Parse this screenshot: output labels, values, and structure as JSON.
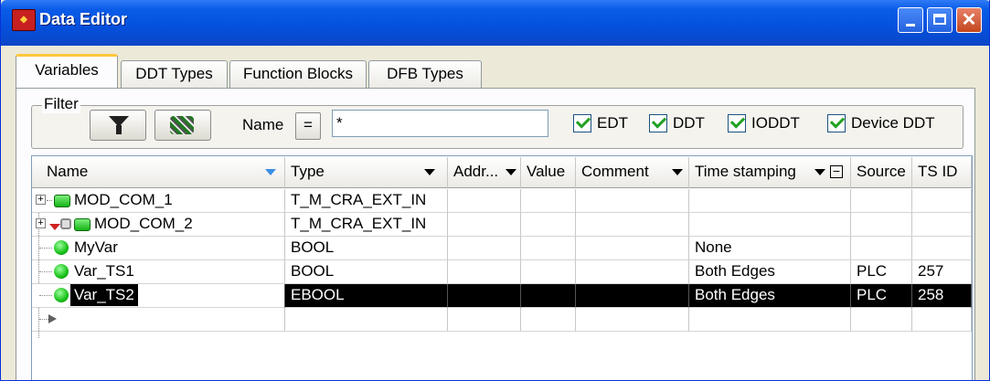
{
  "window": {
    "title": "Data Editor",
    "app_icon": "data-editor-icon"
  },
  "tabs": [
    {
      "label": "Variables",
      "active": true
    },
    {
      "label": "DDT Types",
      "active": false
    },
    {
      "label": "Function Blocks",
      "active": false
    },
    {
      "label": "DFB Types",
      "active": false
    }
  ],
  "filter": {
    "legend": "Filter",
    "name_label": "Name",
    "eq_label": "=",
    "name_value": "*",
    "checks": [
      {
        "label": "EDT",
        "checked": true
      },
      {
        "label": "DDT",
        "checked": true
      },
      {
        "label": "IODDT",
        "checked": true
      },
      {
        "label": "Device DDT",
        "checked": true
      }
    ]
  },
  "columns": [
    "Name",
    "Type",
    "Addr...",
    "Value",
    "Comment",
    "Time stamping",
    "Source",
    "TS ID"
  ],
  "rows": [
    {
      "name": "MOD_COM_1",
      "type": "T_M_CRA_EXT_IN",
      "time_stamping": "",
      "source": "",
      "ts_id": ""
    },
    {
      "name": "MOD_COM_2",
      "type": "T_M_CRA_EXT_IN",
      "time_stamping": "",
      "source": "",
      "ts_id": ""
    },
    {
      "name": "MyVar",
      "type": "BOOL",
      "time_stamping": "None",
      "source": "",
      "ts_id": ""
    },
    {
      "name": "Var_TS1",
      "type": "BOOL",
      "time_stamping": "Both Edges",
      "source": "PLC",
      "ts_id": "257"
    },
    {
      "name": "Var_TS2",
      "type": "EBOOL",
      "time_stamping": "Both Edges",
      "source": "PLC",
      "ts_id": "258"
    }
  ],
  "colors": {
    "title_bar": "#0a5ce8",
    "selected_row": "#000000",
    "tab_highlight": "#ffc83c",
    "check_green": "#21a121"
  }
}
